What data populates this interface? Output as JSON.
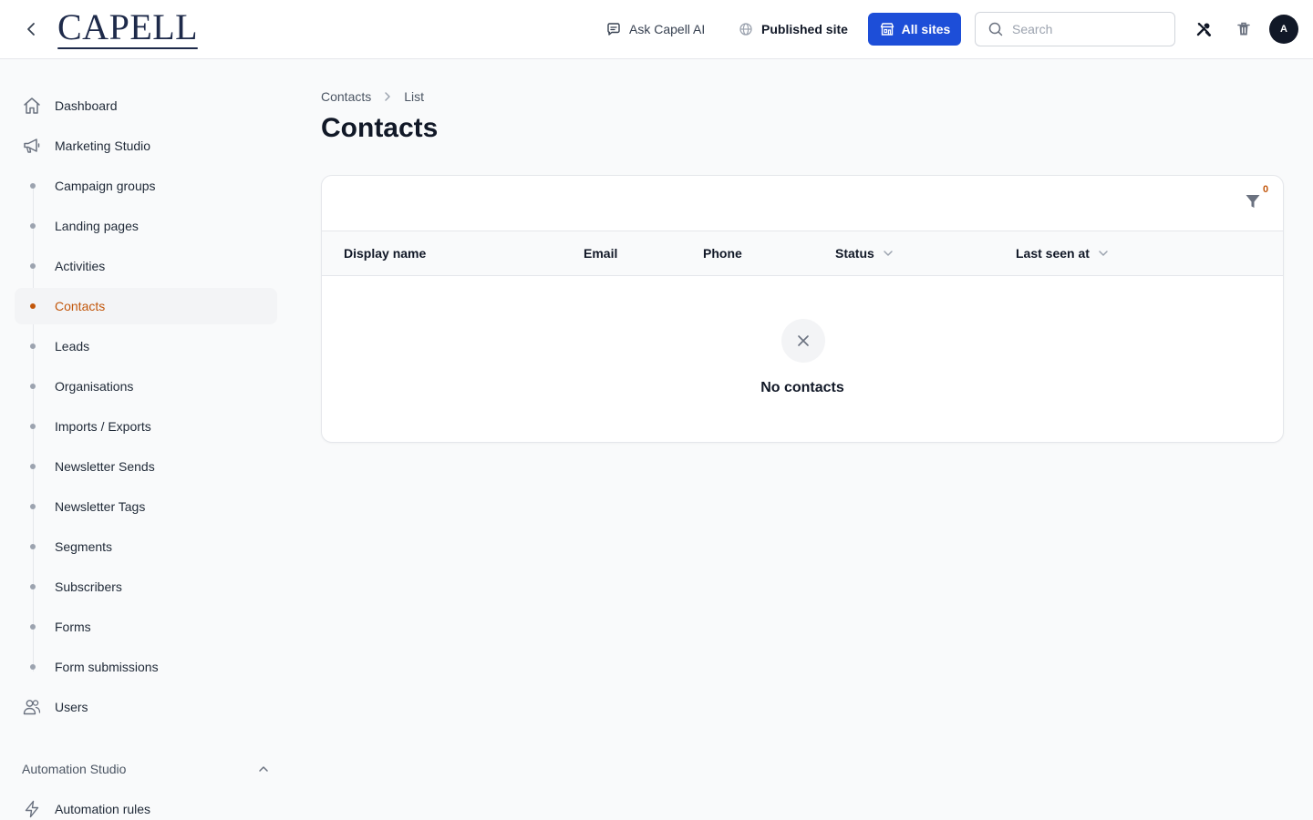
{
  "header": {
    "logo_text": "CAPELL",
    "ask_ai_label": "Ask Capell AI",
    "published_site_label": "Published site",
    "all_sites_label": "All sites",
    "search_placeholder": "Search",
    "avatar_initial": "A",
    "accent_color": "#1d4ed8"
  },
  "sidebar": {
    "items": [
      {
        "label": "Dashboard",
        "icon": "home-icon"
      },
      {
        "label": "Marketing Studio",
        "icon": "megaphone-icon"
      },
      {
        "label": "Campaign groups"
      },
      {
        "label": "Landing pages"
      },
      {
        "label": "Activities"
      },
      {
        "label": "Contacts",
        "active": true
      },
      {
        "label": "Leads"
      },
      {
        "label": "Organisations"
      },
      {
        "label": "Imports / Exports"
      },
      {
        "label": "Newsletter Sends"
      },
      {
        "label": "Newsletter Tags"
      },
      {
        "label": "Segments"
      },
      {
        "label": "Subscribers"
      },
      {
        "label": "Forms"
      },
      {
        "label": "Form submissions"
      },
      {
        "label": "Users",
        "icon": "users-icon"
      }
    ],
    "section_automation": "Automation Studio",
    "automation_items": [
      {
        "label": "Automation rules",
        "icon": "bolt-icon"
      }
    ],
    "active_color": "#c2570c"
  },
  "main": {
    "breadcrumb": [
      "Contacts",
      "List"
    ],
    "title": "Contacts",
    "filter_count": "0",
    "columns": [
      "Display name",
      "Email",
      "Phone",
      "Status",
      "Last seen at"
    ],
    "empty_message": "No contacts"
  }
}
